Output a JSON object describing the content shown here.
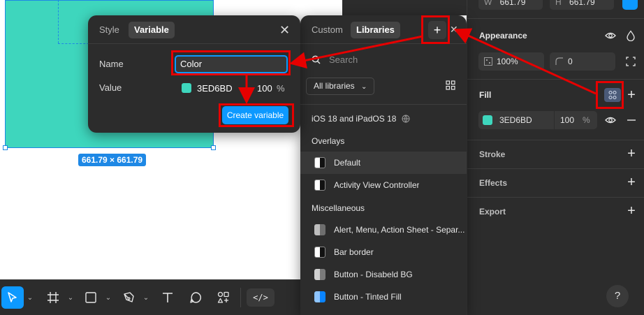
{
  "canvas": {
    "frame_color": "#3ed6bd",
    "size_label": "661.79 × 661.79"
  },
  "variable_dialog": {
    "tabs": [
      "Style",
      "Variable"
    ],
    "active_tab": "Variable",
    "name_label": "Name",
    "name_value": "Color",
    "value_label": "Value",
    "value_hex": "3ED6BD",
    "value_opacity": "100",
    "value_percent": "%",
    "create_label": "Create variable",
    "close_icon": "close-icon"
  },
  "libraries_panel": {
    "tabs": [
      "Custom",
      "Libraries"
    ],
    "active_tab": "Libraries",
    "search_placeholder": "Search",
    "filter_label": "All libraries",
    "library_title": "iOS 18 and iPadOS 18",
    "groups": [
      {
        "label": "Overlays",
        "items": [
          "Default",
          "Activity View Controller"
        ]
      },
      {
        "label": "Miscellaneous",
        "items": [
          "Alert, Menu, Action Sheet - Separ...",
          "Bar border",
          "Button - Disabeld BG",
          "Button - Tinted Fill"
        ]
      }
    ]
  },
  "properties_panel": {
    "w_label": "W",
    "w_value": "661.79",
    "h_label": "H",
    "h_value": "661.79",
    "appearance_label": "Appearance",
    "opacity_value": "100%",
    "radius_value": "0",
    "fill_label": "Fill",
    "fill_hex": "3ED6BD",
    "fill_opacity": "100",
    "fill_percent": "%",
    "stroke_label": "Stroke",
    "effects_label": "Effects",
    "export_label": "Export",
    "help_label": "?"
  },
  "toolbar": {
    "tools": [
      "move-tool",
      "frame-tool",
      "rectangle-tool",
      "pen-tool",
      "text-tool",
      "comment-tool",
      "actions-tool",
      "dev-mode-toggle"
    ],
    "active_tool": "move-tool"
  },
  "colors": {
    "accent": "#0d99ff",
    "annotation_red": "#e60000",
    "panel_bg": "#2c2c2c"
  }
}
